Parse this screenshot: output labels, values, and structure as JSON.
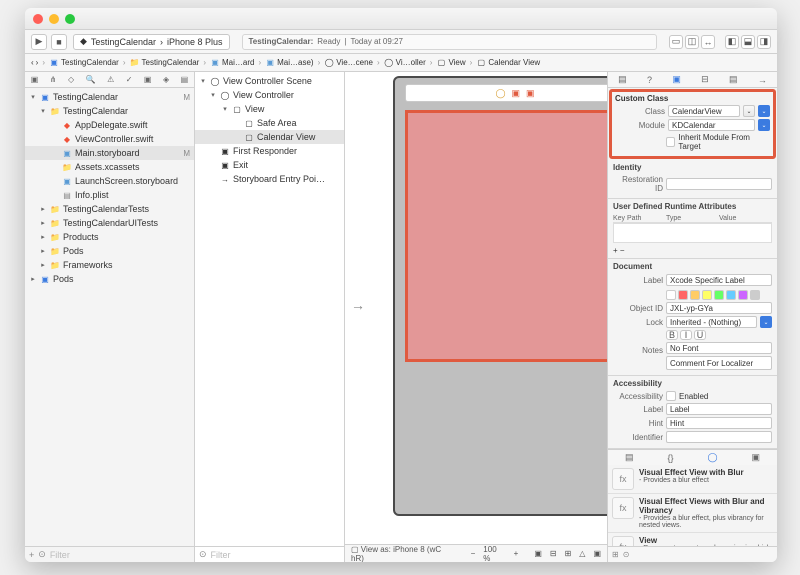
{
  "titlebar": {},
  "toolbar": {
    "run_icon": "play-icon",
    "stop_icon": "stop-icon",
    "scheme": "TestingCalendar",
    "destination": "iPhone 8 Plus",
    "status_app": "TestingCalendar:",
    "status_text": "Ready",
    "status_time": "Today at 09:27"
  },
  "breadcrumbs": [
    {
      "icon": "chev-left",
      "label": ""
    },
    {
      "icon": "chev-right",
      "label": ""
    },
    {
      "icon": "proj",
      "label": "TestingCalendar"
    },
    {
      "icon": "folder",
      "label": "TestingCalendar"
    },
    {
      "icon": "sb",
      "label": "Mai…ard"
    },
    {
      "icon": "sb",
      "label": "Mai…ase)"
    },
    {
      "icon": "scene",
      "label": "Vie…cene"
    },
    {
      "icon": "vc",
      "label": "Vi…oller"
    },
    {
      "icon": "view",
      "label": "View"
    },
    {
      "icon": "view",
      "label": "Calendar View"
    }
  ],
  "nav": {
    "items": [
      {
        "ind": 0,
        "dis": "▾",
        "icon": "proj",
        "cls": "folder-blue",
        "label": "TestingCalendar",
        "badge": "M"
      },
      {
        "ind": 1,
        "dis": "▾",
        "icon": "folder",
        "cls": "folder-yellow",
        "label": "TestingCalendar"
      },
      {
        "ind": 2,
        "dis": "",
        "icon": "swift",
        "cls": "swift-orange",
        "label": "AppDelegate.swift"
      },
      {
        "ind": 2,
        "dis": "",
        "icon": "swift",
        "cls": "swift-orange",
        "label": "ViewController.swift"
      },
      {
        "ind": 2,
        "dis": "",
        "icon": "sb",
        "cls": "sb-icon",
        "label": "Main.storyboard",
        "badge": "M",
        "sel": true
      },
      {
        "ind": 2,
        "dis": "",
        "icon": "folder",
        "cls": "folder-yellow",
        "label": "Assets.xcassets"
      },
      {
        "ind": 2,
        "dis": "",
        "icon": "sb",
        "cls": "sb-icon",
        "label": "LaunchScreen.storyboard"
      },
      {
        "ind": 2,
        "dis": "",
        "icon": "plist",
        "cls": "pl-icon",
        "label": "Info.plist"
      },
      {
        "ind": 1,
        "dis": "▸",
        "icon": "folder",
        "cls": "folder-yellow",
        "label": "TestingCalendarTests"
      },
      {
        "ind": 1,
        "dis": "▸",
        "icon": "folder",
        "cls": "folder-yellow",
        "label": "TestingCalendarUITests"
      },
      {
        "ind": 1,
        "dis": "▸",
        "icon": "folder",
        "cls": "folder-yellow",
        "label": "Products"
      },
      {
        "ind": 1,
        "dis": "▸",
        "icon": "folder",
        "cls": "folder-yellow",
        "label": "Pods"
      },
      {
        "ind": 1,
        "dis": "▸",
        "icon": "folder",
        "cls": "folder-yellow",
        "label": "Frameworks"
      },
      {
        "ind": 0,
        "dis": "▸",
        "icon": "proj",
        "cls": "folder-blue",
        "label": "Pods"
      }
    ],
    "filter_placeholder": "Filter"
  },
  "outline": {
    "items": [
      {
        "ind": 0,
        "dis": "▾",
        "icon": "scene",
        "label": "View Controller Scene"
      },
      {
        "ind": 1,
        "dis": "▾",
        "icon": "vc",
        "label": "View Controller"
      },
      {
        "ind": 2,
        "dis": "▾",
        "icon": "view",
        "label": "View"
      },
      {
        "ind": 3,
        "dis": "",
        "icon": "safe",
        "label": "Safe Area"
      },
      {
        "ind": 3,
        "dis": "",
        "icon": "view",
        "label": "Calendar View",
        "sel": true
      },
      {
        "ind": 1,
        "dis": "",
        "icon": "first",
        "label": "First Responder"
      },
      {
        "ind": 1,
        "dis": "",
        "icon": "exit",
        "label": "Exit"
      },
      {
        "ind": 1,
        "dis": "",
        "icon": "entry",
        "label": "Storyboard Entry Poi…"
      }
    ],
    "filter_placeholder": "Filter"
  },
  "canvas": {
    "footer_label": "View as: iPhone 8 (wC hR)",
    "zoom": "100 %"
  },
  "inspector": {
    "custom_class": {
      "title": "Custom Class",
      "class_label": "Class",
      "class_value": "CalendarView",
      "module_label": "Module",
      "module_value": "KDCalendar",
      "inherit_label": "Inherit Module From Target"
    },
    "identity": {
      "title": "Identity",
      "restoration_label": "Restoration ID",
      "restoration_value": ""
    },
    "runtime": {
      "title": "User Defined Runtime Attributes",
      "col1": "Key Path",
      "col2": "Type",
      "col3": "Value"
    },
    "document": {
      "title": "Document",
      "label_label": "Label",
      "label_placeholder": "Xcode Specific Label",
      "objectid_label": "Object ID",
      "objectid_value": "JXL-yp-GYa",
      "lock_label": "Lock",
      "lock_value": "Inherited - (Nothing)",
      "notes_label": "Notes",
      "notes_font_placeholder": "No Font",
      "notes_placeholder": "Comment For Localizer"
    },
    "accessibility": {
      "title": "Accessibility",
      "acc_label": "Accessibility",
      "enabled_label": "Enabled",
      "label_label": "Label",
      "label_placeholder": "Label",
      "hint_label": "Hint",
      "hint_placeholder": "Hint",
      "identifier_label": "Identifier"
    },
    "library": [
      {
        "title": "Visual Effect View with Blur",
        "desc": "Provides a blur effect"
      },
      {
        "title": "Visual Effect Views with Blur and Vibrancy",
        "desc": "Provides a blur effect, plus vibrancy for nested views."
      },
      {
        "title": "View",
        "desc": "Represents a rectangular region in which it draws and receives events."
      }
    ]
  }
}
